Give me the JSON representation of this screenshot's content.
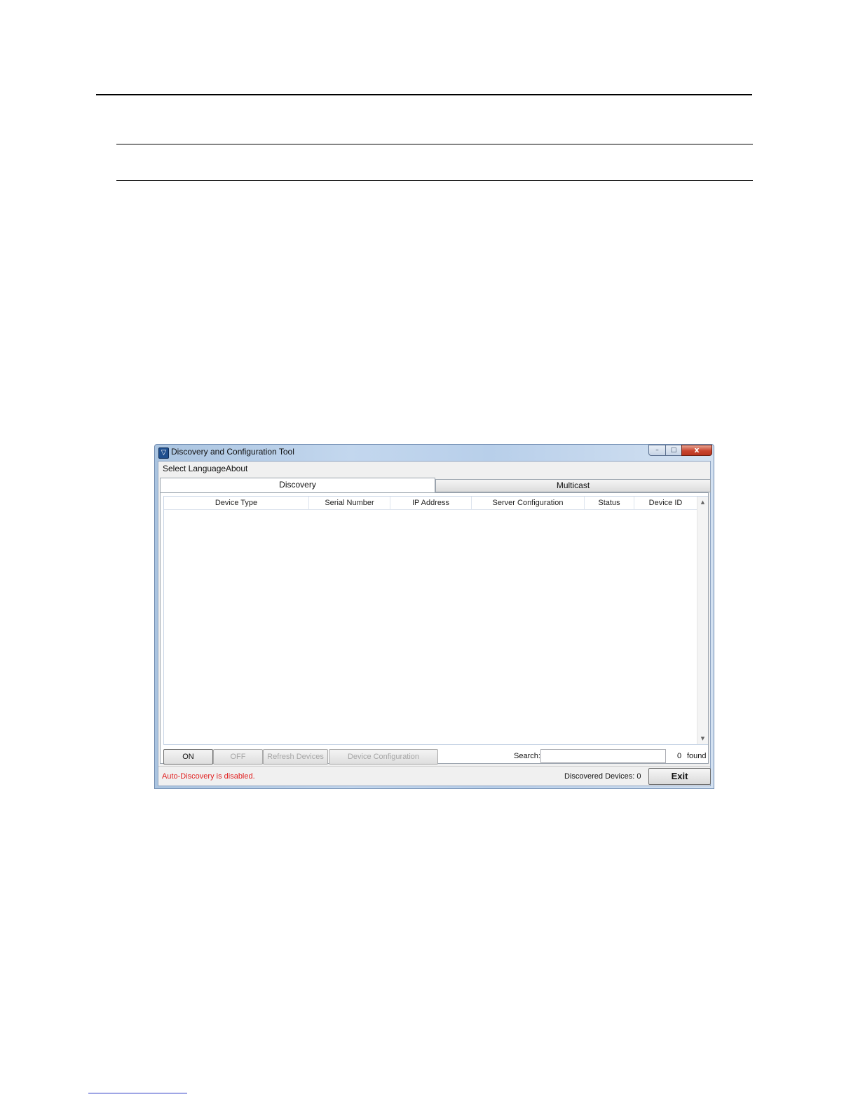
{
  "window": {
    "title": "Discovery and Configuration Tool",
    "icon": "shield-logo-icon",
    "controls": {
      "minimize": "–",
      "maximize": "□",
      "close": "x"
    }
  },
  "menu": {
    "select_language": "Select Language",
    "about": "About"
  },
  "tabs": [
    {
      "label": "Discovery",
      "active": true
    },
    {
      "label": "Multicast",
      "active": false
    }
  ],
  "grid": {
    "columns": [
      "Device Type",
      "Serial Number",
      "IP Address",
      "Server Configuration",
      "Status",
      "Device ID"
    ],
    "rows": []
  },
  "toolbar": {
    "on_label": "ON",
    "off_label": "OFF",
    "refresh_label": "Refresh Devices",
    "config_label": "Device Configuration",
    "search_label": "Search:",
    "search_value": "",
    "found_count": "0",
    "found_label": "found"
  },
  "status": {
    "message": "Auto-Discovery is disabled.",
    "discovered": "Discovered Devices: 0",
    "exit_label": "Exit"
  },
  "colors": {
    "status_error": "#e02020",
    "titlebar": "#c3d7ee",
    "close_button": "#c9452f"
  }
}
